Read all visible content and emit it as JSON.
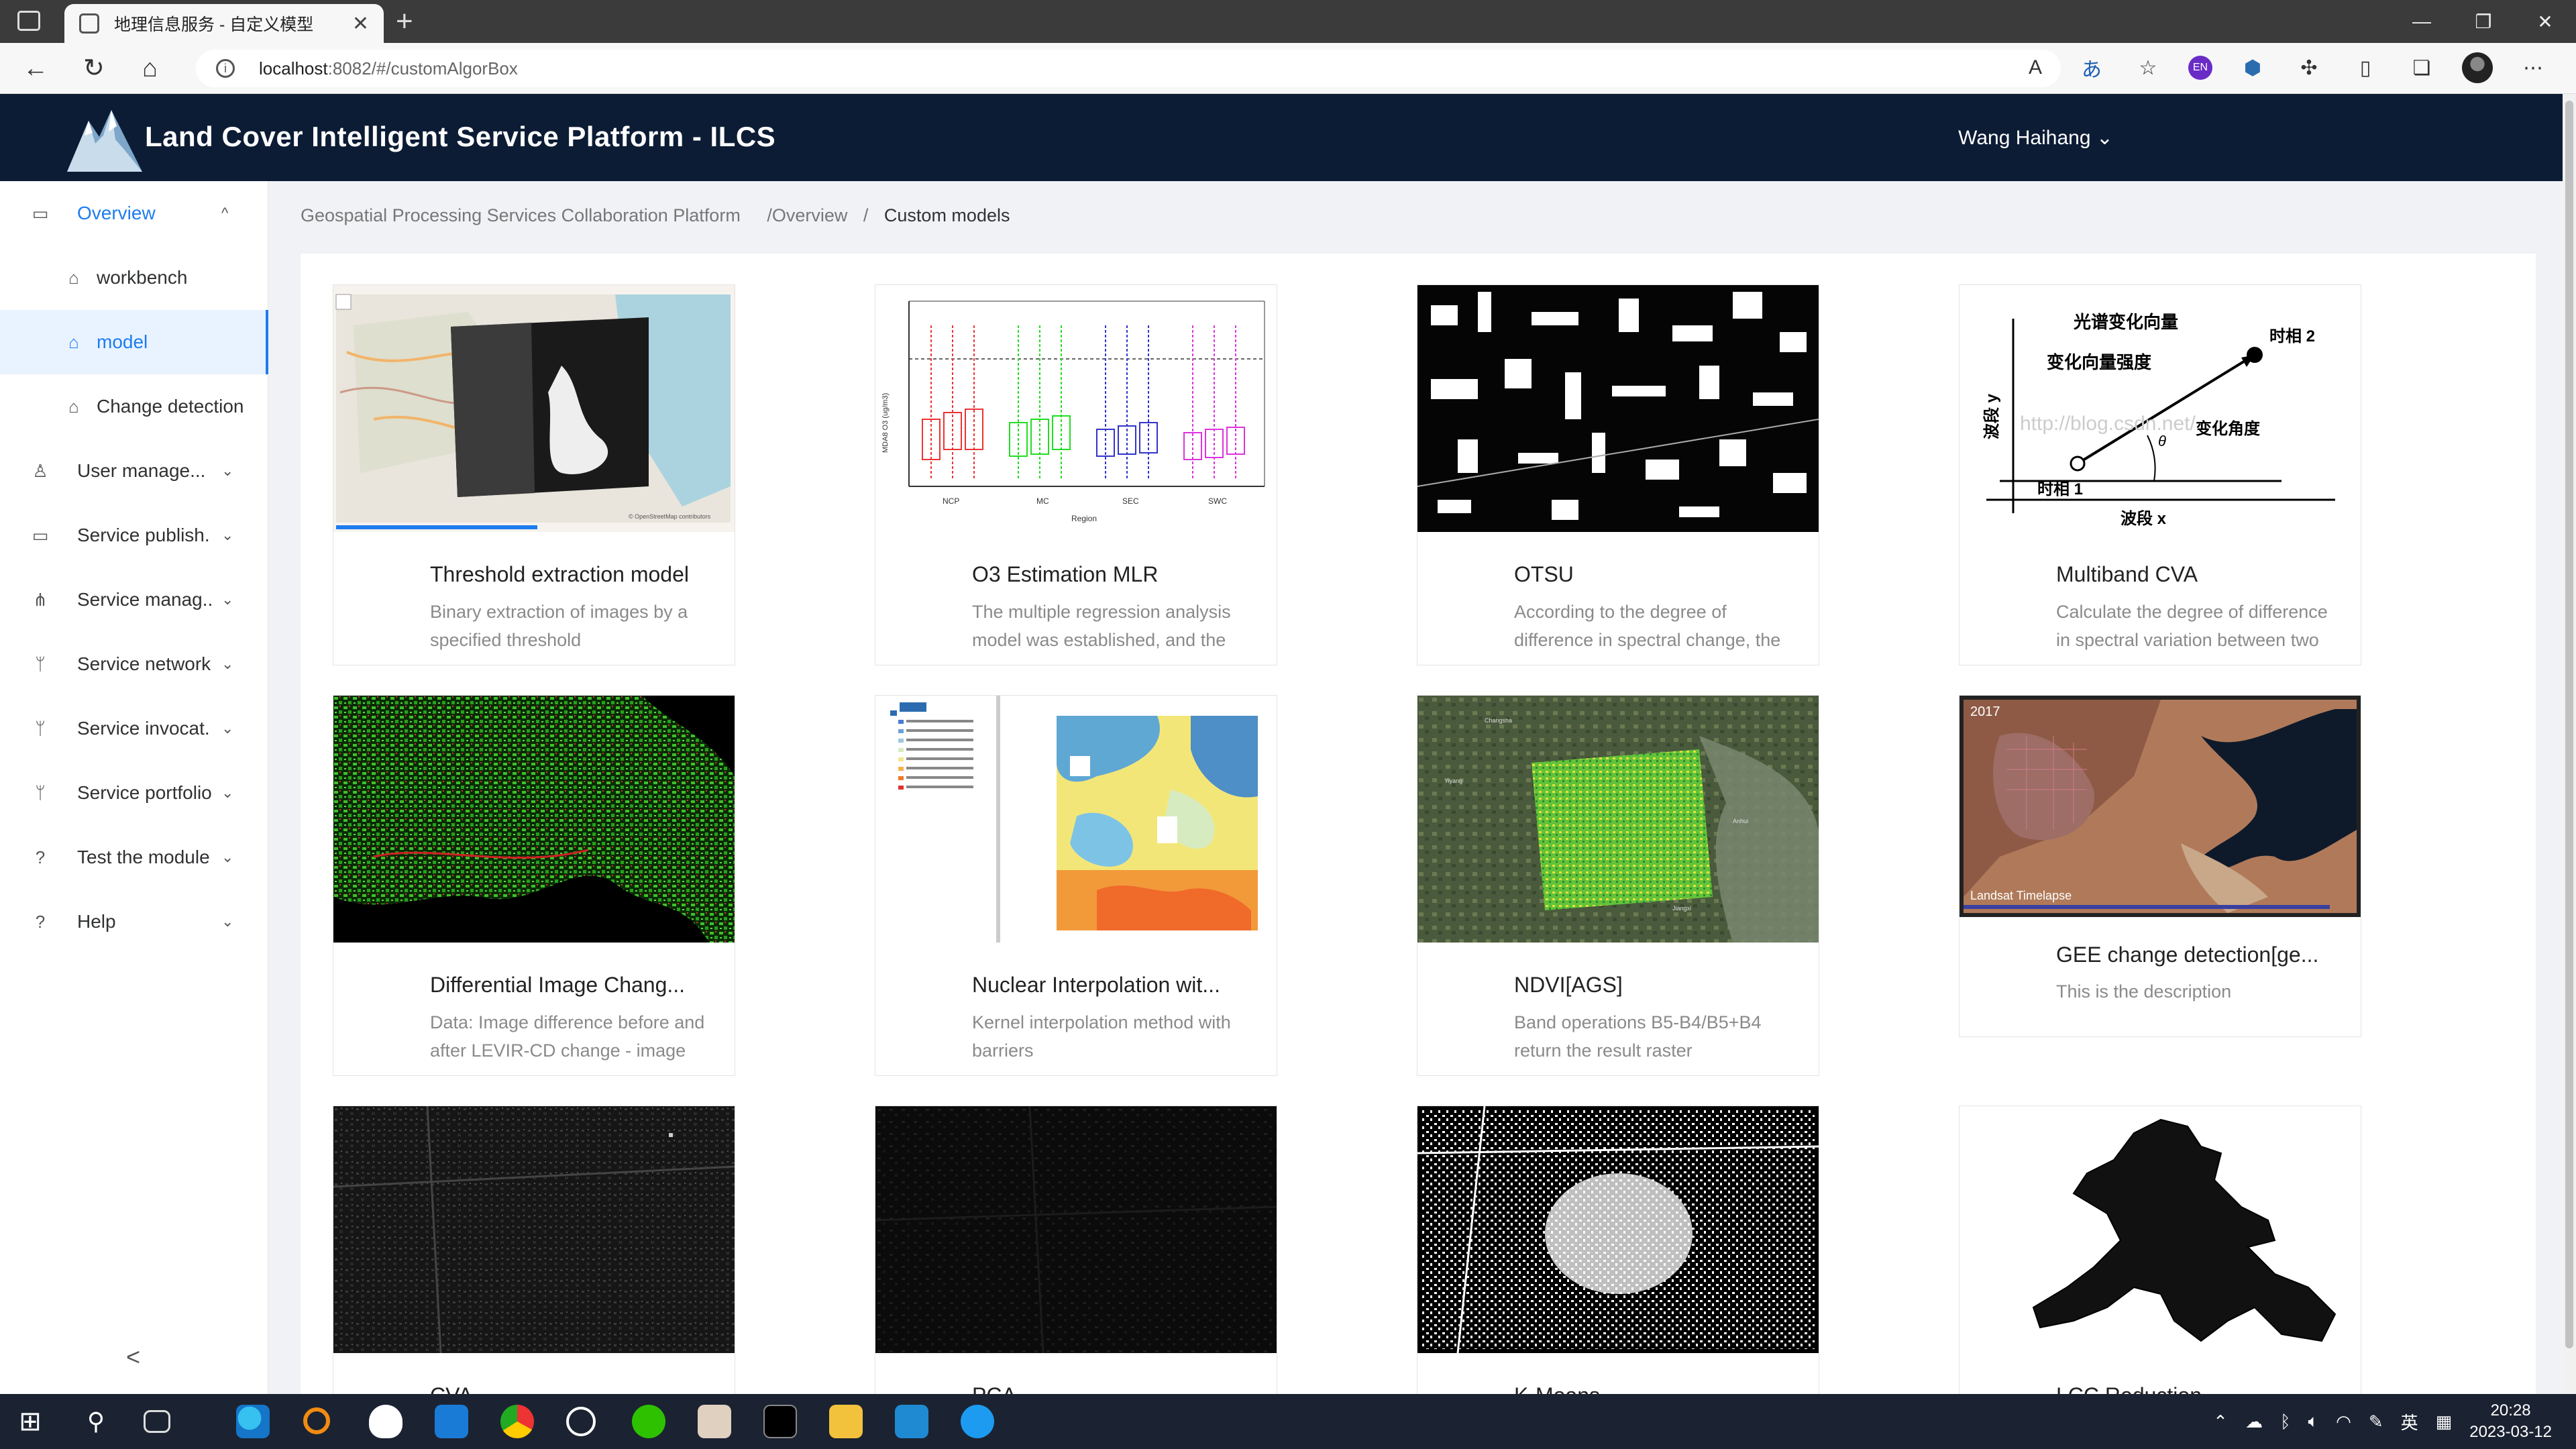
{
  "browser": {
    "tab_title": "地理信息服务 - 自定义模型",
    "url_host": "localhost",
    "url_rest": ":8082/#/customAlgorBox",
    "lang_badge": "EN"
  },
  "header": {
    "title": "Land Cover Intelligent Service Platform - ILCS",
    "user": "Wang Haihang ⌄"
  },
  "sidebar": {
    "items": [
      {
        "label": "Overview",
        "arrow": "^",
        "icon": "book-icon"
      },
      {
        "label": "workbench",
        "icon": "bank-icon"
      },
      {
        "label": "model",
        "icon": "bank-icon"
      },
      {
        "label": "Change detection",
        "icon": "bank-icon"
      },
      {
        "label": "User manage...",
        "arrow": "⌄",
        "icon": "user-icon"
      },
      {
        "label": "Service publish...",
        "arrow": "⌄",
        "icon": "monitor-icon"
      },
      {
        "label": "Service manag...",
        "arrow": "⌄",
        "icon": "org-icon"
      },
      {
        "label": "Service network",
        "arrow": "⌄",
        "icon": "branch-icon"
      },
      {
        "label": "Service invocat...",
        "arrow": "⌄",
        "icon": "branch-icon"
      },
      {
        "label": "Service portfolio",
        "arrow": "⌄",
        "icon": "branch-icon"
      },
      {
        "label": "Test the module",
        "arrow": "⌄",
        "icon": "question-icon"
      },
      {
        "label": "Help",
        "arrow": "⌄",
        "icon": "question-icon"
      }
    ],
    "collapse": "<"
  },
  "breadcrumb": {
    "root": "Geospatial Processing Services Collaboration Platform",
    "mid": "/Overview",
    "sep": "/",
    "current": "Custom models"
  },
  "cards": [
    {
      "title": "Threshold extraction model",
      "desc": "Binary extraction of images by a specified threshold"
    },
    {
      "title": "O3 Estimation MLR",
      "desc": "The multiple regression analysis model was established, and the estimation model was"
    },
    {
      "title": "OTSU",
      "desc": "According to the degree of difference in spectral change, the threshold is selected to"
    },
    {
      "title": "Multiband CVA",
      "desc": "Calculate the degree of difference in spectral variation between two time-phase remote"
    },
    {
      "title": "Differential Image Chang...",
      "desc": "Data: Image difference before and after LEVIR-CD change - image classification coloring."
    },
    {
      "title": "Nuclear Interpolation wit...",
      "desc": "Kernel interpolation method with barriers"
    },
    {
      "title": "NDVI[AGS]",
      "desc": "Band operations B5-B4/B5+B4 return the result raster"
    },
    {
      "title": "GEE change detection[ge...",
      "desc": "This is the description"
    },
    {
      "title": "CVA",
      "desc": ""
    },
    {
      "title": "PCA",
      "desc": ""
    },
    {
      "title": "K-Means",
      "desc": ""
    },
    {
      "title": "LCC Reduction",
      "desc": ""
    }
  ],
  "image_text": {
    "cva_labels": [
      "光谱变化向量",
      "变化向量强度",
      "时相 2",
      "变化角度",
      "时相 1",
      "波段 x",
      "波段 y",
      "θ"
    ],
    "cva_watermark": "http://blog.csdn.net/",
    "o3_regions": [
      "NCP",
      "MC",
      "SEC",
      "SWC"
    ],
    "o3_xlabel": "Region",
    "o3_ylabel": "MDA8 O3 (ug/m3)",
    "gee_overlay": "Landsat Timelapse",
    "gee_year": "2017",
    "map_attrib": "© OpenStreetMap contributors"
  },
  "taskbar": {
    "time": "20:28",
    "date": "2023-03-12",
    "ime": "英"
  }
}
